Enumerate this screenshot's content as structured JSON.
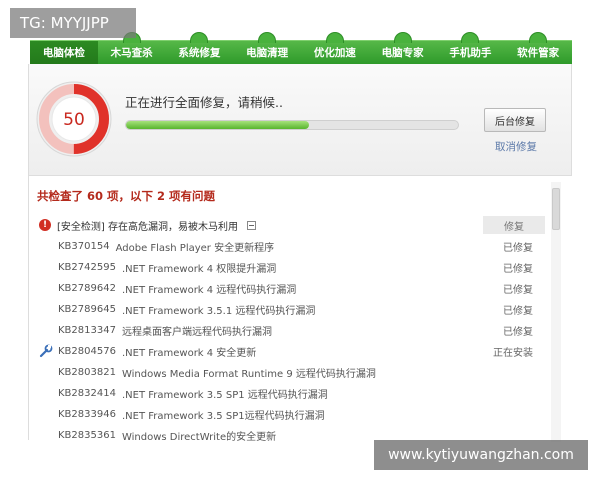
{
  "watermark_top": "TG: MYYJJPP",
  "watermark_bottom": "www.kytiyuwangzhan.com",
  "nav": {
    "items": [
      "电脑体检",
      "木马查杀",
      "系统修复",
      "电脑清理",
      "优化加速",
      "电脑专家",
      "手机助手",
      "软件管家"
    ],
    "active_index": 0
  },
  "status": {
    "gauge_value": "50",
    "title": "正在进行全面修复，请稍候..",
    "progress_percent": 55,
    "background_button": "后台修复",
    "cancel_link": "取消修复"
  },
  "results": {
    "summary": "共检查了 60 项，以下 2 项有问题",
    "section": {
      "label": "[安全检测] 存在高危漏洞，易被木马利用",
      "status": "修复"
    },
    "items": [
      {
        "kb": "KB370154",
        "desc": "Adobe Flash Player 安全更新程序",
        "state": "已修复",
        "icon": ""
      },
      {
        "kb": "KB2742595",
        "desc": ".NET Framework 4 权限提升漏洞",
        "state": "已修复",
        "icon": ""
      },
      {
        "kb": "KB2789642",
        "desc": ".NET Framework 4 远程代码执行漏洞",
        "state": "已修复",
        "icon": ""
      },
      {
        "kb": "KB2789645",
        "desc": ".NET Framework 3.5.1 远程代码执行漏洞",
        "state": "已修复",
        "icon": ""
      },
      {
        "kb": "KB2813347",
        "desc": "远程桌面客户端远程代码执行漏洞",
        "state": "已修复",
        "icon": ""
      },
      {
        "kb": "KB2804576",
        "desc": ".NET Framework 4 安全更新",
        "state": "正在安装",
        "icon": "wrench-icon"
      },
      {
        "kb": "KB2803821",
        "desc": "Windows Media Format Runtime 9 远程代码执行漏洞",
        "state": "",
        "icon": ""
      },
      {
        "kb": "KB2832414",
        "desc": ".NET Framework 3.5 SP1 远程代码执行漏洞",
        "state": "",
        "icon": ""
      },
      {
        "kb": "KB2833946",
        "desc": ".NET Framework 3.5 SP1远程代码执行漏洞",
        "state": "",
        "icon": ""
      },
      {
        "kb": "KB2835361",
        "desc": "Windows DirectWrite的安全更新",
        "state": "",
        "icon": ""
      }
    ]
  },
  "colors": {
    "nav_green": "#3ea935",
    "gauge_red": "#e0322a",
    "summary_red": "#b42a1c",
    "progress_green": "#58b52e"
  }
}
